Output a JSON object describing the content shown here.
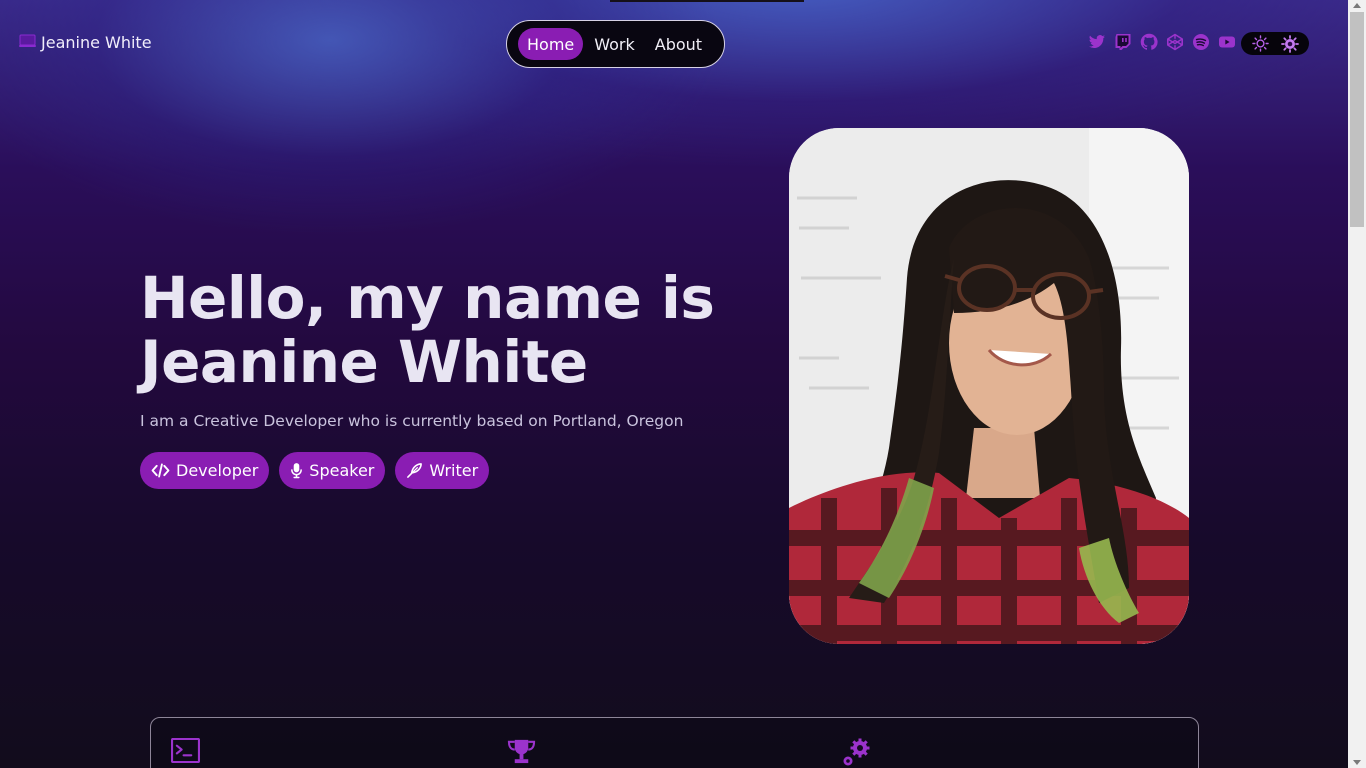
{
  "header": {
    "brand_name": "Jeanine White",
    "brand_icon": "laptop-icon",
    "nav": [
      {
        "label": "Home",
        "active": true
      },
      {
        "label": "Work",
        "active": false
      },
      {
        "label": "About",
        "active": false
      }
    ],
    "socials": [
      "twitter-icon",
      "twitch-icon",
      "github-icon",
      "codepen-icon",
      "spotify-icon",
      "youtube-icon"
    ],
    "theme_toggle": [
      "sun-icon",
      "gear-sun-icon"
    ]
  },
  "hero": {
    "title_line1": "Hello, my name is",
    "title_line2": "Jeanine White",
    "subtitle": "I am a Creative Developer who is currently based on Portland, Oregon",
    "tags": [
      {
        "label": "Developer",
        "icon": "code-icon"
      },
      {
        "label": "Speaker",
        "icon": "microphone-icon"
      },
      {
        "label": "Writer",
        "icon": "pen-icon"
      }
    ]
  },
  "features": {
    "icons": [
      "terminal-icon",
      "trophy-icon",
      "gears-icon"
    ]
  },
  "colors": {
    "accent": "#8a1db3",
    "icon_purple": "#9b33cc",
    "text": "#e8e5f2"
  }
}
